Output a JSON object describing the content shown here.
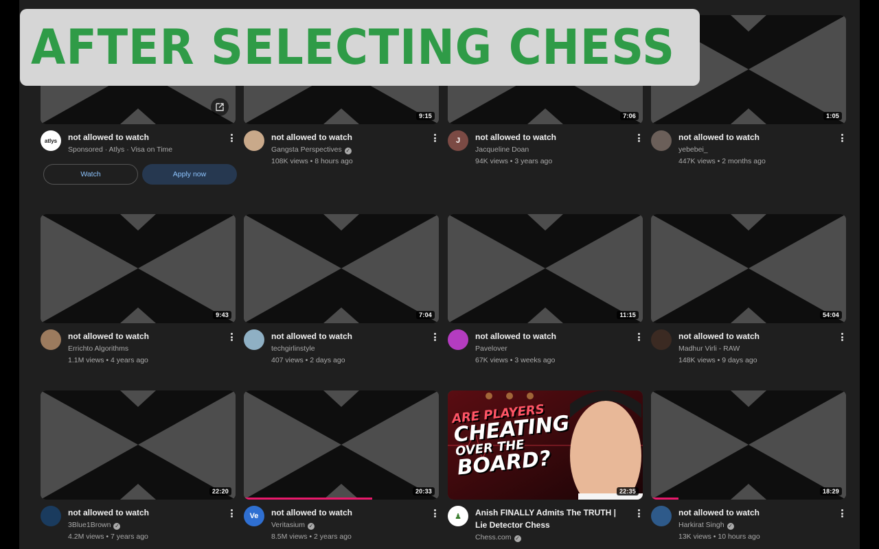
{
  "banner": {
    "text": "AFTER SELECTING CHESS"
  },
  "videos": [
    {
      "title": "not allowed to watch",
      "channel": "Sponsored · Atlys · Visa on Time",
      "stats": "",
      "duration": "",
      "sponsored": true,
      "avatar_text": "atlys",
      "avatar_color": "#ffffff",
      "avatar_fg": "#111111",
      "verified": false,
      "progress": 0,
      "buttons": {
        "watch": "Watch",
        "apply": "Apply now"
      }
    },
    {
      "title": "not allowed to watch",
      "channel": "Gangsta Perspectives",
      "stats": "108K views • 8 hours ago",
      "duration": "9:15",
      "avatar_text": "",
      "avatar_color": "#c9a98a",
      "verified": true,
      "progress": 0
    },
    {
      "title": "not allowed to watch",
      "channel": "Jacqueline Doan",
      "stats": "94K views • 3 years ago",
      "duration": "7:06",
      "avatar_text": "J",
      "avatar_color": "#7b4a44",
      "verified": false,
      "progress": 0
    },
    {
      "title": "not allowed to watch",
      "channel": "yebebei_",
      "stats": "447K views • 2 months ago",
      "duration": "1:05",
      "avatar_text": "",
      "avatar_color": "#6b5f59",
      "verified": false,
      "progress": 0
    },
    {
      "title": "not allowed to watch",
      "channel": "Errichto Algorithms",
      "stats": "1.1M views • 4 years ago",
      "duration": "9:43",
      "avatar_text": "",
      "avatar_color": "#9c7b5e",
      "verified": false,
      "progress": 0
    },
    {
      "title": "not allowed to watch",
      "channel": "techgirlinstyle",
      "stats": "407 views • 2 days ago",
      "duration": "7:04",
      "avatar_text": "",
      "avatar_color": "#8fb0c4",
      "verified": false,
      "progress": 0
    },
    {
      "title": "not allowed to watch",
      "channel": "Pavelover",
      "stats": "67K views • 3 weeks ago",
      "duration": "11:15",
      "avatar_text": "",
      "avatar_color": "#b43cc0",
      "verified": false,
      "progress": 0
    },
    {
      "title": "not allowed to watch",
      "channel": "Madhur Virli - RAW",
      "stats": "148K views • 9 days ago",
      "duration": "54:04",
      "avatar_text": "",
      "avatar_color": "#3b2a22",
      "verified": false,
      "progress": 0
    },
    {
      "title": "not allowed to watch",
      "channel": "3Blue1Brown",
      "stats": "4.2M views • 7 years ago",
      "duration": "22:20",
      "avatar_text": "",
      "avatar_color": "#1a3b5e",
      "verified": true,
      "progress": 0
    },
    {
      "title": "not allowed to watch",
      "channel": "Veritasium",
      "stats": "8.5M views • 2 years ago",
      "duration": "20:33",
      "avatar_text": "Ve",
      "avatar_color": "#2f6fd1",
      "verified": true,
      "progress": 0.66
    },
    {
      "title": "Anish FINALLY Admits The TRUTH | Lie Detector Chess",
      "channel": "Chess.com",
      "stats": "",
      "duration": "22:35",
      "avatar_text": "♟",
      "avatar_color": "#ffffff",
      "avatar_fg": "#3a7d2e",
      "verified": true,
      "progress": 0,
      "custom_thumb": true,
      "thumb_text": [
        "ARE PLAYERS",
        "CHEATING",
        "OVER THE",
        "BOARD?"
      ]
    },
    {
      "title": "not allowed to watch",
      "channel": "Harkirat Singh",
      "stats": "13K views • 10 hours ago",
      "duration": "18:29",
      "avatar_text": "",
      "avatar_color": "#2e5a8a",
      "verified": true,
      "progress": 0.14
    }
  ],
  "colors": {
    "background": "#1f1f1f",
    "banner_text": "#2f9b47",
    "banner_bg": "#d6d6d6",
    "progress": "#e8196b"
  }
}
